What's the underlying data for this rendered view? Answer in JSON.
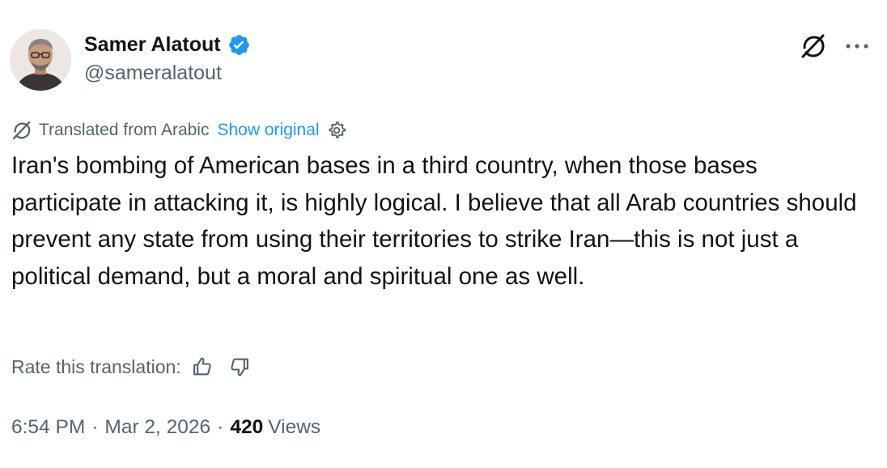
{
  "author": {
    "display_name": "Samer Alatout",
    "handle": "@sameralatout",
    "verified": true,
    "verified_color": "#1d9bf0"
  },
  "header_actions": {
    "translate_icon": "translate-slash-icon",
    "more_icon": "more-dots-icon"
  },
  "translation": {
    "icon": "translate-slash-icon",
    "label": "Translated from Arabic",
    "show_original": "Show original",
    "settings_icon": "gear-icon",
    "link_color": "#1d9bf0"
  },
  "post": {
    "text": "Iran's bombing of American bases in a third country, when those bases participate in attacking it, is highly logical. I believe that all Arab countries should prevent any state from using their territories to strike Iran—this is not just a political demand, but a moral and spiritual one as well."
  },
  "rating": {
    "label": "Rate this translation:",
    "thumbs_up_icon": "thumbs-up-icon",
    "thumbs_down_icon": "thumbs-down-icon"
  },
  "meta": {
    "time": "6:54 PM",
    "separator": "·",
    "date": "Mar 2, 2026",
    "views_count": "420",
    "views_label": "Views"
  }
}
